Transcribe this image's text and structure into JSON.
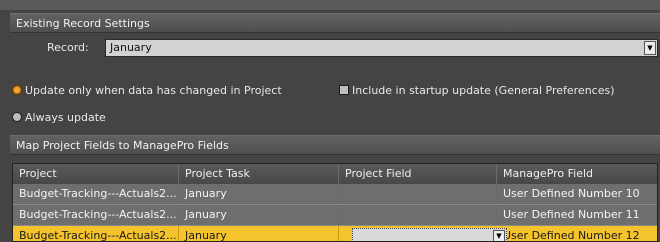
{
  "existing_record": {
    "header": "Existing Record Settings",
    "record_label": "Record:",
    "record_value": "January"
  },
  "options": {
    "update_when_changed": {
      "label": "Update only when data has changed in Project",
      "selected": true
    },
    "always_update": {
      "label": "Always update",
      "selected": false
    },
    "include_startup": {
      "label": "Include in startup update (General Preferences)",
      "checked": false
    }
  },
  "mapping": {
    "header": "Map Project Fields to ManagePro Fields",
    "columns": [
      "Project",
      "Project Task",
      "Project Field",
      "ManagePro Field"
    ],
    "rows": [
      {
        "project": "Budget-Tracking---Actuals2...",
        "task": "January",
        "field": "",
        "managepro": "User Defined Number 10"
      },
      {
        "project": "Budget-Tracking---Actuals2...",
        "task": "January",
        "field": "",
        "managepro": "User Defined Number 11"
      },
      {
        "project": "Budget-Tracking---Actuals2...",
        "task": "January",
        "field": "",
        "managepro": "User Defined Number 12",
        "selected": true
      }
    ]
  },
  "icons": {
    "dropdown": "chevron-down-icon"
  },
  "colors": {
    "selection": "#f5c32c",
    "radio_selected": "#f6a531",
    "background": "#444444"
  }
}
